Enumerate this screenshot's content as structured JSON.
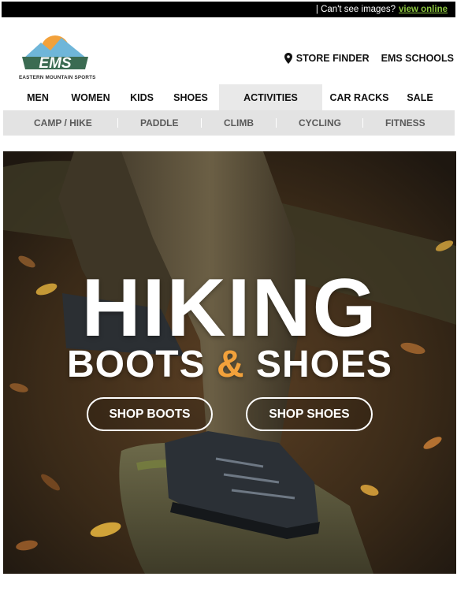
{
  "topbar": {
    "notice": "| Can't see images?",
    "link": "view online"
  },
  "brand": {
    "logo_text": "EMS",
    "tagline": "EASTERN MOUNTAIN SPORTS",
    "colors": {
      "green": "#3b6b52",
      "orange": "#f2a13b",
      "sky": "#6fb6d9"
    }
  },
  "header_links": {
    "store_finder": "STORE FINDER",
    "schools": "EMS SCHOOLS",
    "store_icon": "map-pin-icon"
  },
  "nav": {
    "items": [
      {
        "label": "MEN"
      },
      {
        "label": "WOMEN"
      },
      {
        "label": "KIDS"
      },
      {
        "label": "SHOES"
      },
      {
        "label": "ACTIVITIES",
        "active": true
      },
      {
        "label": "CAR RACKS"
      },
      {
        "label": "SALE"
      }
    ]
  },
  "subnav": {
    "items": [
      {
        "label": "CAMP / HIKE"
      },
      {
        "label": "PADDLE"
      },
      {
        "label": "CLIMB"
      },
      {
        "label": "CYCLING"
      },
      {
        "label": "FITNESS"
      }
    ]
  },
  "hero": {
    "title": "HIKING",
    "subtitle_a": "BOOTS",
    "subtitle_amp": "&",
    "subtitle_b": "SHOES",
    "btn_boots": "SHOP BOOTS",
    "btn_shoes": "SHOP SHOES",
    "accent": "#f2a13b"
  }
}
